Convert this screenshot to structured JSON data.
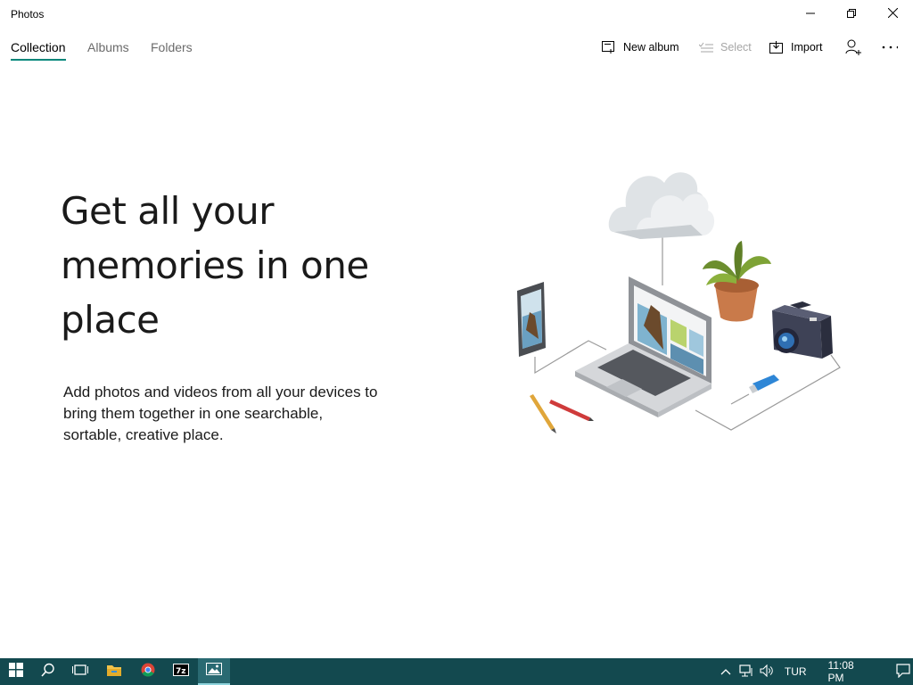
{
  "app": {
    "title": "Photos"
  },
  "window_controls": {
    "minimize_icon": "minimize-icon",
    "restore_icon": "restore-icon",
    "close_icon": "close-icon"
  },
  "nav": {
    "tabs": [
      {
        "label": "Collection",
        "active": true
      },
      {
        "label": "Albums",
        "active": false
      },
      {
        "label": "Folders",
        "active": false
      }
    ],
    "accent_color": "#00867a"
  },
  "toolbar": {
    "new_album_label": "New album",
    "select_label": "Select",
    "select_disabled": true,
    "import_label": "Import",
    "account_icon": "person-add-icon",
    "more_icon": "more-ellipsis-icon"
  },
  "hero": {
    "title_lines": [
      "Get all your",
      "memories in one",
      "place"
    ],
    "description_lines": [
      "Add photos and videos from all your devices to",
      "bring them together in one searchable,",
      "sortable, creative place."
    ]
  },
  "taskbar": {
    "background": "#13494f",
    "items": [
      "windows-start-icon",
      "search-icon",
      "task-view-icon",
      "file-explorer-icon",
      "chrome-icon",
      "7zip-icon",
      "photos-app-icon"
    ],
    "tray": {
      "language": "TUR",
      "time": "11:08 PM"
    }
  }
}
